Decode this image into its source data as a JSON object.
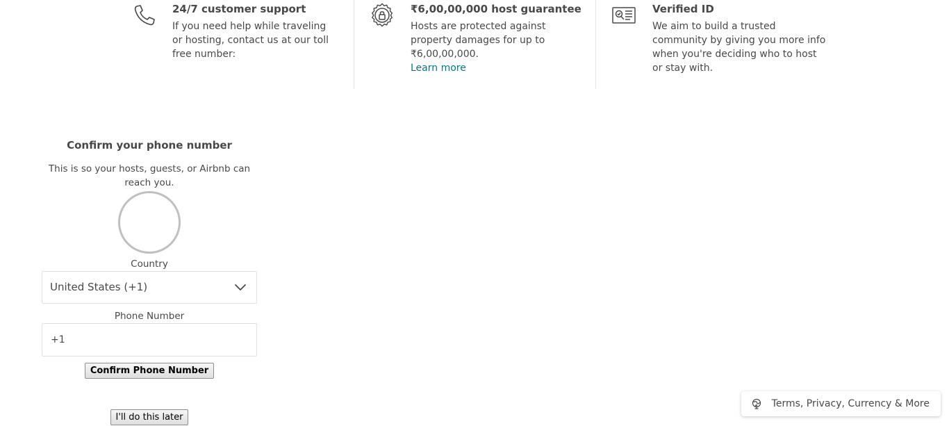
{
  "features": [
    {
      "icon": "phone-icon",
      "title": "24/7 customer support",
      "description": "If you need help while traveling or hosting, contact us at our toll free number:"
    },
    {
      "icon": "badge-lock-icon",
      "title": "₹6,00,00,000 host guarantee",
      "description": "Hosts are protected against property damages for up to ₹6,00,00,000.",
      "link": "Learn more"
    },
    {
      "icon": "id-card-icon",
      "title": "Verified ID",
      "description": "We aim to build a trusted community by giving you more info when you're deciding who to host or stay with."
    }
  ],
  "confirm_phone": {
    "title": "Confirm your phone number",
    "subtitle": "This is so your hosts, guests, or Airbnb can reach you.",
    "country_label": "Country",
    "country_value": "United States (+1)",
    "phone_label": "Phone Number",
    "phone_value": "+1",
    "confirm_button": "Confirm Phone Number",
    "later_button": "I'll do this later"
  },
  "footer": {
    "text": "Terms, Privacy, Currency & More"
  },
  "colors": {
    "text": "#484848",
    "link": "#007a87",
    "border": "#e0e0e0"
  }
}
